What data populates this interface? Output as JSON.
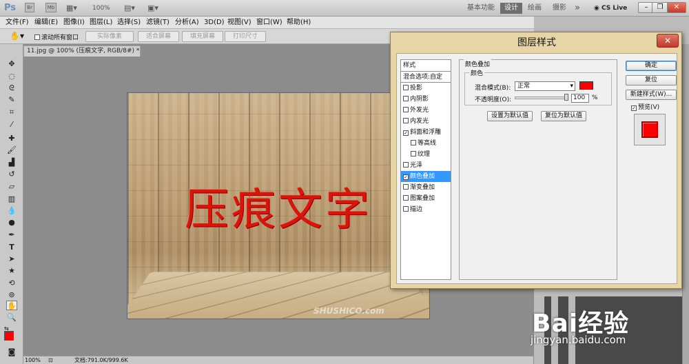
{
  "app": {
    "logo": "Ps",
    "zoom_top": "100%",
    "workspaces": [
      "基本功能",
      "设计",
      "绘画",
      "摄影"
    ],
    "active_workspace": "设计",
    "overflow": "»",
    "cs_live": "CS Live"
  },
  "menu": [
    "文件(F)",
    "编辑(E)",
    "图像(I)",
    "图层(L)",
    "选择(S)",
    "滤镜(T)",
    "分析(A)",
    "3D(D)",
    "视图(V)",
    "窗口(W)",
    "帮助(H)"
  ],
  "options": {
    "scroll_all": "滚动所有窗口",
    "buttons": [
      "实际像素",
      "适合屏幕",
      "填充屏幕",
      "打印尺寸"
    ]
  },
  "document": {
    "tab_title": "11.jpg @ 100% (压痕文字, RGB/8#) *",
    "canvas_text": "压痕文字",
    "watermark": "SHUSHICO.com"
  },
  "status": {
    "zoom": "100%",
    "doc_info": "文档:791.0K/999.6K"
  },
  "dialog": {
    "title": "图层样式",
    "close": "✕",
    "list_header": "样式",
    "list_blend": "混合选项:自定",
    "items": [
      {
        "label": "投影",
        "checked": false,
        "sub": false
      },
      {
        "label": "内阴影",
        "checked": false,
        "sub": false
      },
      {
        "label": "外发光",
        "checked": false,
        "sub": false
      },
      {
        "label": "内发光",
        "checked": false,
        "sub": false
      },
      {
        "label": "斜面和浮雕",
        "checked": true,
        "sub": false
      },
      {
        "label": "等高线",
        "checked": false,
        "sub": true
      },
      {
        "label": "纹理",
        "checked": false,
        "sub": true
      },
      {
        "label": "光泽",
        "checked": false,
        "sub": false
      },
      {
        "label": "颜色叠加",
        "checked": true,
        "sub": false,
        "selected": true
      },
      {
        "label": "渐变叠加",
        "checked": false,
        "sub": false
      },
      {
        "label": "图案叠加",
        "checked": false,
        "sub": false
      },
      {
        "label": "描边",
        "checked": false,
        "sub": false
      }
    ],
    "panel": {
      "section_title": "颜色叠加",
      "group_title": "颜色",
      "blend_mode_label": "混合模式(B):",
      "blend_mode_value": "正常",
      "overlay_color": "#ff0000",
      "opacity_label": "不透明度(O):",
      "opacity_value": "100",
      "opacity_unit": "%",
      "set_default": "设置为默认值",
      "reset_default": "复位为默认值"
    },
    "buttons": {
      "ok": "确定",
      "reset": "复位",
      "new_style": "新建样式(W)...",
      "preview": "预览(V)"
    }
  },
  "watermark_site": {
    "logo": "Bai经验",
    "url": "jingyan.baidu.com"
  }
}
